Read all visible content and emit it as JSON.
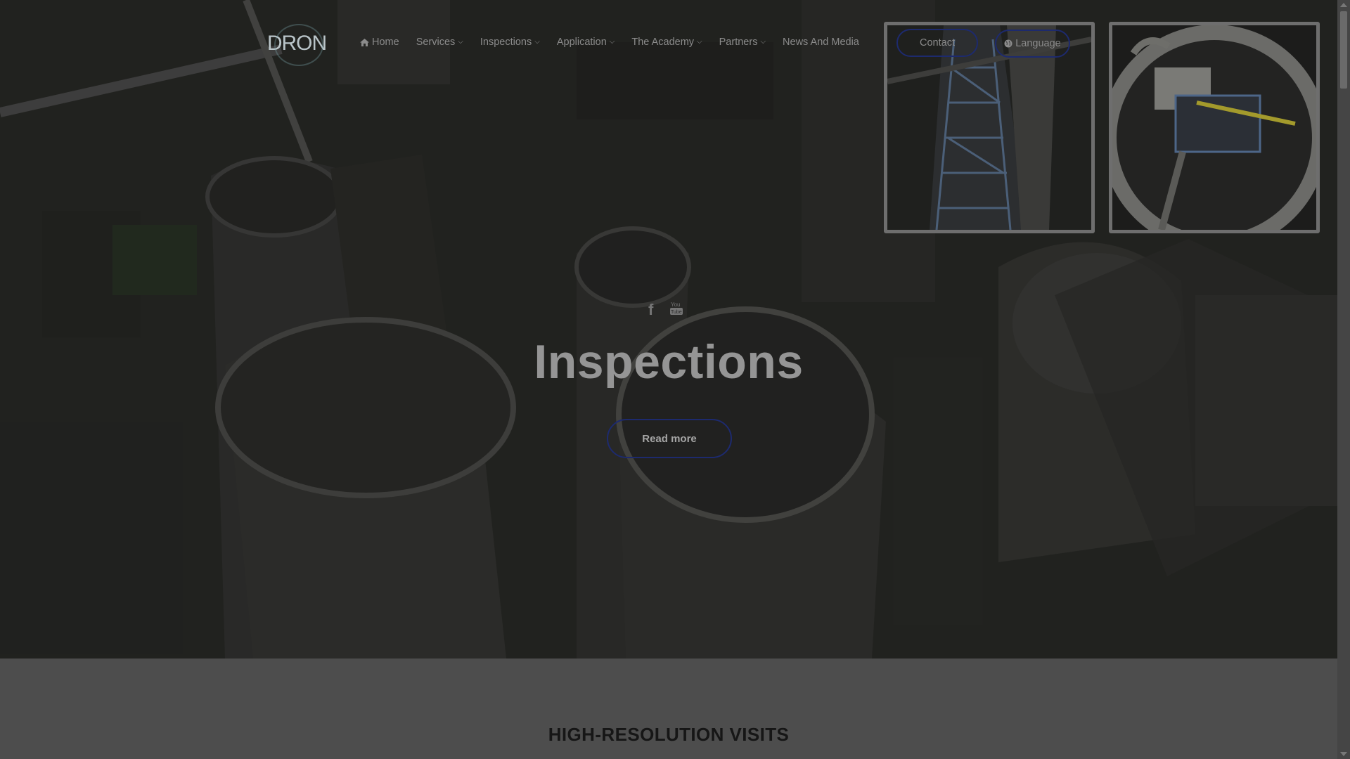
{
  "brand": {
    "logo_text": "DRON"
  },
  "nav": {
    "items": [
      {
        "label": "Home",
        "icon": "home-icon",
        "has_dropdown": false
      },
      {
        "label": "Services",
        "has_dropdown": true
      },
      {
        "label": "Inspections",
        "has_dropdown": true
      },
      {
        "label": "Application",
        "has_dropdown": true
      },
      {
        "label": "The Academy",
        "has_dropdown": true
      },
      {
        "label": "Partners",
        "has_dropdown": true
      },
      {
        "label": "News And Media",
        "has_dropdown": false
      }
    ],
    "contact_label": "Contact",
    "language_label": "Language"
  },
  "social": {
    "icons": [
      "facebook-icon",
      "youtube-icon"
    ]
  },
  "hero": {
    "title": "Inspections",
    "button_label": "Read more"
  },
  "section": {
    "title": "HIGH-RESOLUTION VISITS"
  },
  "colors": {
    "accent_border": "#1d2a6e",
    "overlay": "#4d4d4d"
  }
}
